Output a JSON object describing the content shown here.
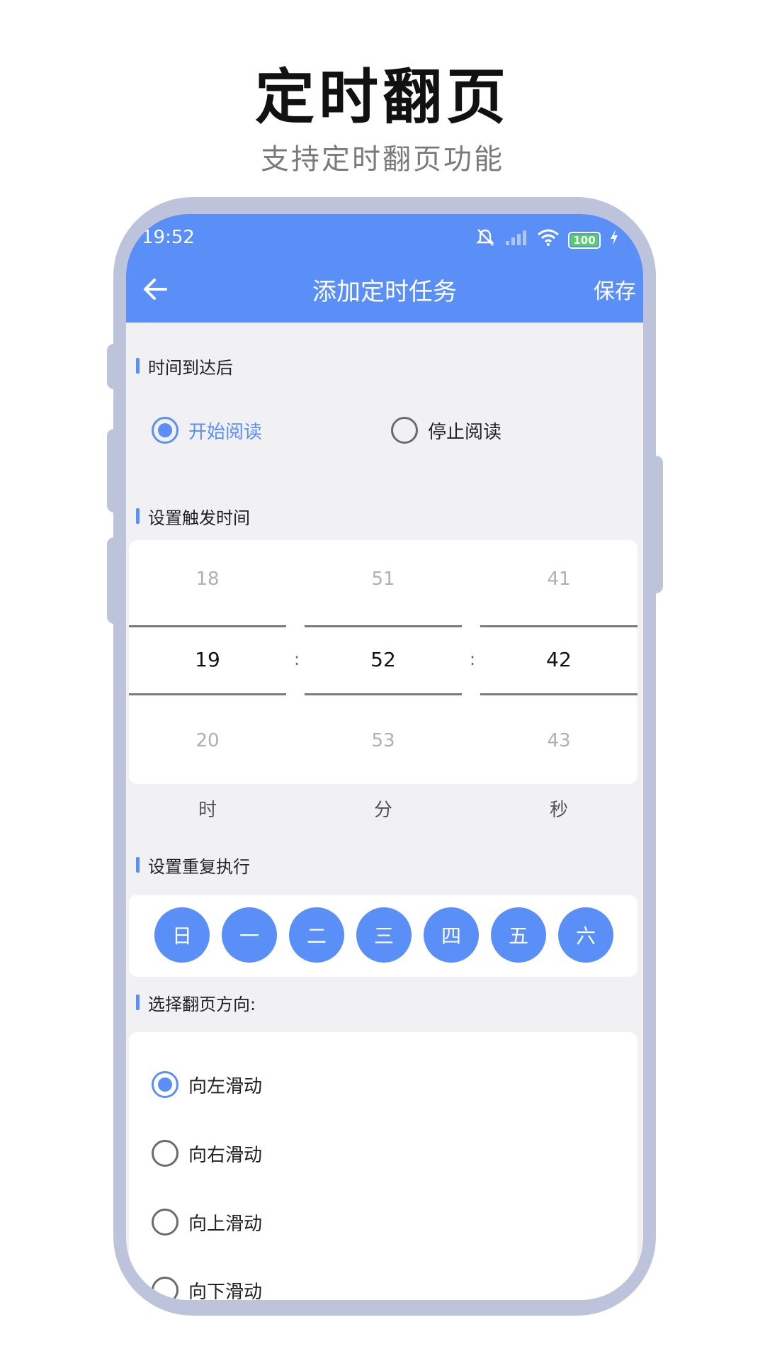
{
  "promo": {
    "title": "定时翻页",
    "subtitle": "支持定时翻页功能"
  },
  "status_bar": {
    "time": "19:52",
    "battery_level": "100",
    "icons": [
      "mute-bell-icon",
      "signal-off-icon",
      "wifi-icon",
      "battery-icon",
      "charging-bolt-icon"
    ]
  },
  "app_bar": {
    "title": "添加定时任务",
    "save_label": "保存",
    "back_icon": "arrow-left-icon"
  },
  "after_time": {
    "label": "时间到达后",
    "options": [
      {
        "label": "开始阅读",
        "checked": true
      },
      {
        "label": "停止阅读",
        "checked": false
      }
    ]
  },
  "trigger_time": {
    "label": "设置触发时间",
    "separator": ":",
    "columns": [
      {
        "prev": "18",
        "current": "19",
        "next": "20",
        "unit": "时"
      },
      {
        "prev": "51",
        "current": "52",
        "next": "53",
        "unit": "分"
      },
      {
        "prev": "41",
        "current": "42",
        "next": "43",
        "unit": "秒"
      }
    ]
  },
  "repeat": {
    "label": "设置重复执行",
    "days": [
      "日",
      "一",
      "二",
      "三",
      "四",
      "五",
      "六"
    ]
  },
  "direction": {
    "label": "选择翻页方向:",
    "options": [
      {
        "label": "向左滑动",
        "checked": true
      },
      {
        "label": "向右滑动",
        "checked": false
      },
      {
        "label": "向上滑动",
        "checked": false
      },
      {
        "label": "向下滑动",
        "checked": false
      }
    ]
  },
  "colors": {
    "accent": "#5a8ff8",
    "frame": "#bdc3da",
    "screen_bg": "#f1f1f4"
  }
}
